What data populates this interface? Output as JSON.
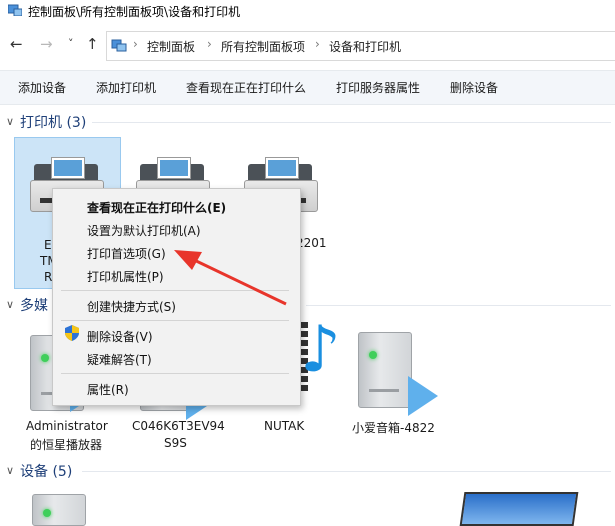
{
  "window": {
    "title": "控制面板\\所有控制面板项\\设备和打印机"
  },
  "nav": {
    "back": "←",
    "forward": "→",
    "dropdown": "˅",
    "up": "↑",
    "separator": "›"
  },
  "breadcrumb": [
    "控制面板",
    "所有控制面板项",
    "设备和打印机"
  ],
  "toolbar": {
    "add_device": "添加设备",
    "add_printer": "添加打印机",
    "see_printing": "查看现在正在打印什么",
    "print_server": "打印服务器属性",
    "remove_device": "删除设备"
  },
  "groups": {
    "printers": "打印机 (3)",
    "multimedia": "多媒",
    "devices": "设备 (5)"
  },
  "printers": {
    "item1_partial": [
      "E",
      "TM",
      "R"
    ],
    "item3_partial": "2201"
  },
  "media_items": [
    {
      "line1": "Administrator",
      "line2": "的恒星播放器"
    },
    {
      "line1": "C046K6T3EV94",
      "line2": "S9S"
    },
    {
      "line1": "NUTAK",
      "line2": ""
    },
    {
      "line1": "小爱音箱-4822",
      "line2": ""
    }
  ],
  "context_menu": {
    "items": [
      "查看现在正在打印什么(E)",
      "设置为默认打印机(A)",
      "打印首选项(G)",
      "打印机属性(P)",
      "创建快捷方式(S)",
      "删除设备(V)",
      "疑难解答(T)",
      "属性(R)"
    ]
  },
  "colors": {
    "accent_header": "#1e3f78",
    "selection": "#cce4f7",
    "arrow": "#e8352b",
    "toolbar_bg": "#f3f6fa"
  }
}
